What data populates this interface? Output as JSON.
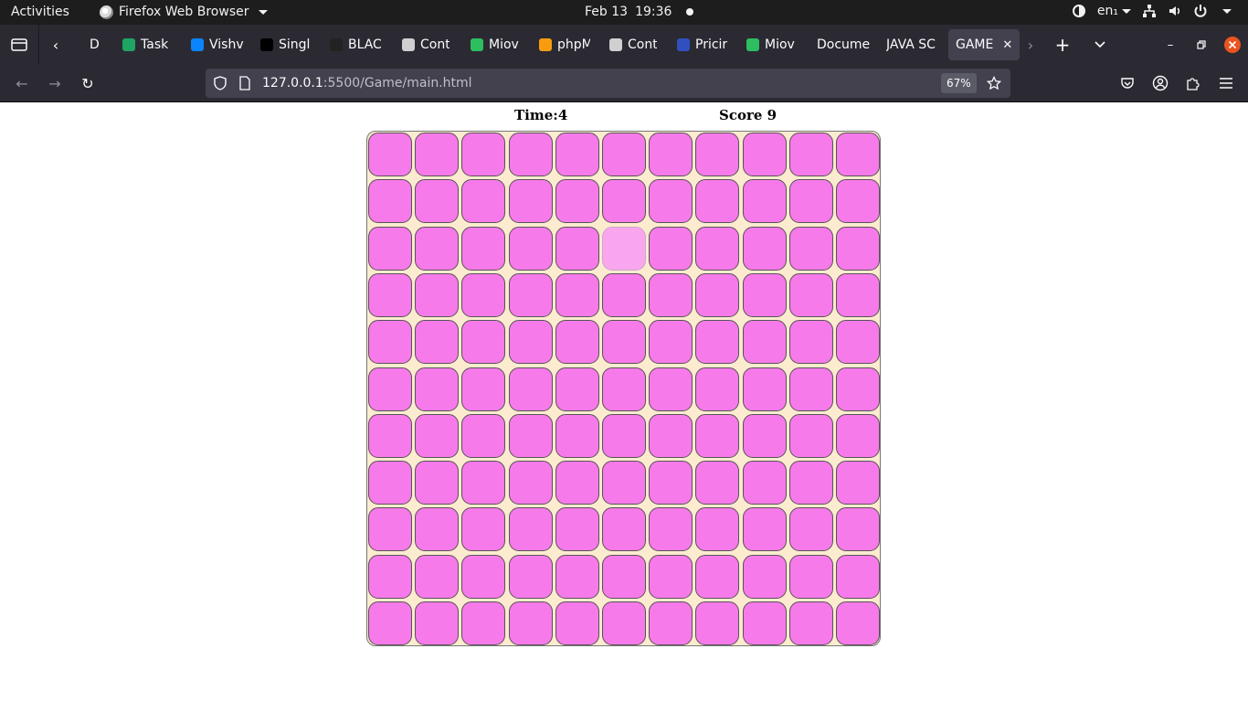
{
  "system_bar": {
    "activities": "Activities",
    "app_name": "Firefox Web Browser",
    "date": "Feb 13",
    "time": "19:36",
    "language": "en₁"
  },
  "tabs": [
    {
      "label": "Drea",
      "icon": "page-icon",
      "color": "#2b2a33"
    },
    {
      "label": "Task",
      "icon": "sheets-icon",
      "color": "#1fa463"
    },
    {
      "label": "Vishv",
      "icon": "onedrive-icon",
      "color": "#0a84ff"
    },
    {
      "label": "Singl",
      "icon": "va-icon",
      "color": "#000000"
    },
    {
      "label": "BLAC",
      "icon": "github-icon",
      "color": "#222222"
    },
    {
      "label": "Cont",
      "icon": "document-icon",
      "color": "#d0d0d0"
    },
    {
      "label": "Miov",
      "icon": "evernote-icon",
      "color": "#2dbe60"
    },
    {
      "label": "phpM",
      "icon": "phpmyadmin-icon",
      "color": "#f89c0e"
    },
    {
      "label": "Cont",
      "icon": "document-icon",
      "color": "#d0d0d0"
    },
    {
      "label": "Pricir",
      "icon": "m-icon",
      "color": "#3050c0"
    },
    {
      "label": "Miov",
      "icon": "evernote-icon",
      "color": "#2dbe60"
    },
    {
      "label": "Docume",
      "icon": "",
      "color": ""
    },
    {
      "label": "JAVA SC",
      "icon": "",
      "color": ""
    },
    {
      "label": "GAME",
      "icon": "",
      "color": "",
      "active": true
    }
  ],
  "address_bar": {
    "host": "127.0.0.1",
    "path": ":5500/Game/main.html",
    "zoom": "67%"
  },
  "game": {
    "time_label": "Time:4",
    "score_label": "Score 9",
    "rows": 11,
    "cols": 11,
    "tile_color": "#f77aea",
    "board_color": "#fdebd0",
    "faded_tiles": [
      [
        2,
        5
      ]
    ]
  }
}
